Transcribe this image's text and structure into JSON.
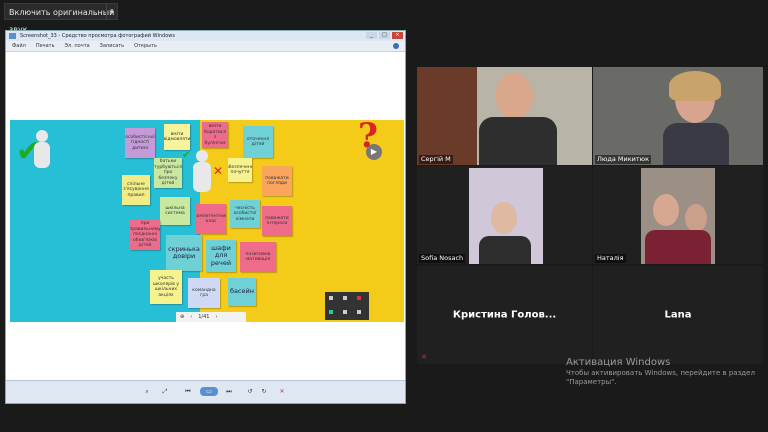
{
  "top_button": {
    "label": "Включить оригинальный звук"
  },
  "viewer": {
    "title": "Screenshot_33 - Средство просмотра фотографий Windows",
    "menu": [
      "Файл",
      "Печать",
      "Эл. почта",
      "Записать",
      "Открыть"
    ],
    "pager": "1/41"
  },
  "slide": {
    "notes": [
      "особистісної гідності дитині",
      "вміти відмовляти",
      "вміти боротися з булінгом",
      "оточення дітей",
      "батьки турбуються про безпеку дітей",
      "спільне з'ясування правил",
      "забезпечення почуття",
      "поважати погляди",
      "шкільна система",
      "власна конкретна мета",
      "інформація дітей",
      "з повагою",
      "вміння слухати",
      "компетентний клас",
      "чесність особистої кімнати",
      "поважати інтереси",
      "при правильному поєднанні обов'язків дітей",
      "скринька довіри",
      "шафи для речей",
      "позитивна мотивація",
      "участь школярів у шкільних акціях",
      "командна гра",
      "басейн"
    ]
  },
  "participants": [
    {
      "name": "Сергій М",
      "active": true
    },
    {
      "name": "Люда Микитюк",
      "active": false
    },
    {
      "name": "Sofia Nosach",
      "active": false
    },
    {
      "name": "Наталія",
      "active": false
    },
    {
      "name": "Кристина  Голов...",
      "active": false
    },
    {
      "name": "Lana",
      "active": false
    }
  ],
  "activation": {
    "title": "Активация Windows",
    "text": "Чтобы активировать Windows, перейдите в раздел \"Параметры\"."
  },
  "colors": {
    "active_border": "#d6e24a",
    "slide_blue": "#27bfd6",
    "slide_yellow": "#f5cb1a"
  }
}
